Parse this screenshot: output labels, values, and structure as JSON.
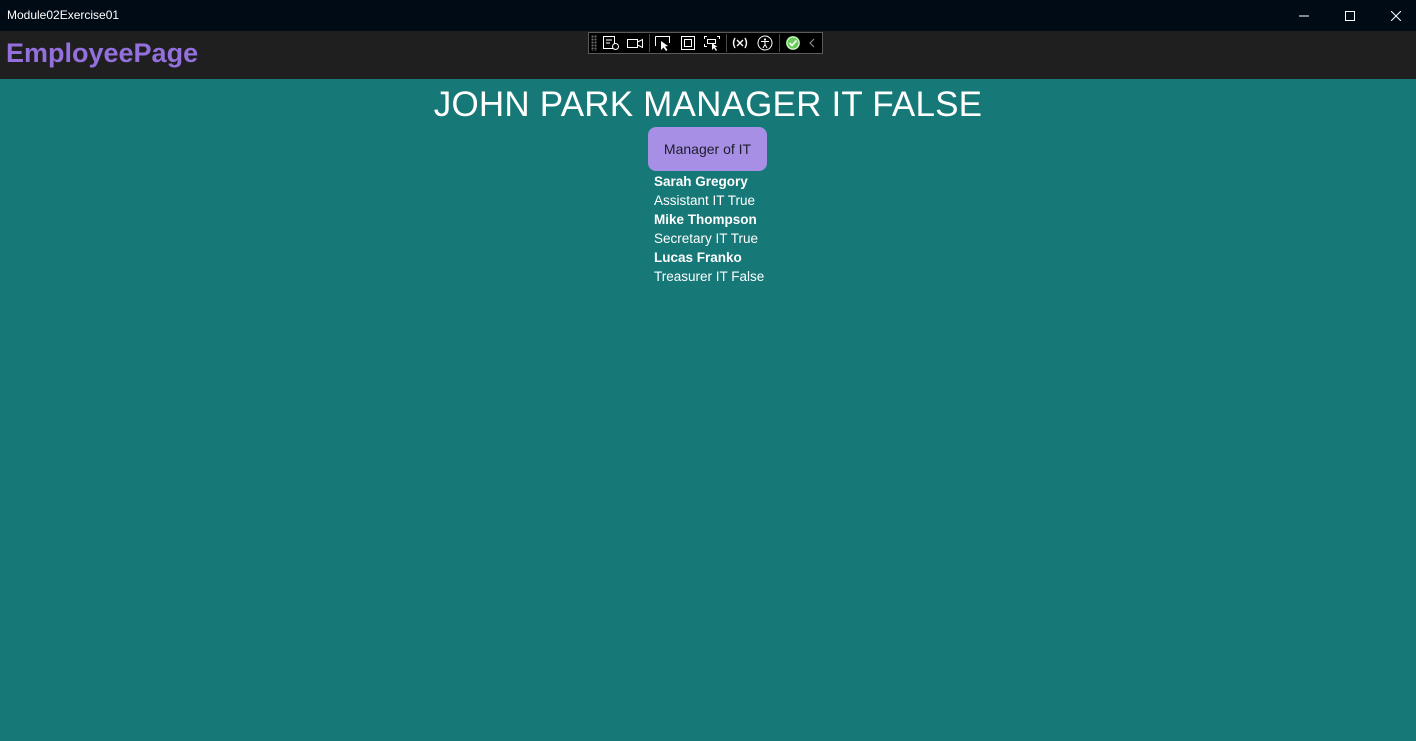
{
  "window": {
    "title": "Module02Exercise01"
  },
  "navbar": {
    "title": "EmployeePage"
  },
  "debug_toolbar": {
    "tools": [
      "live-visual-tree-icon",
      "record-icon",
      "select-element-icon",
      "display-layout-adorners-icon",
      "track-focused-element-icon",
      "binding-failures-icon",
      "accessibility-checker-icon",
      "check-icon",
      "collapse-chevron-icon"
    ]
  },
  "main": {
    "heading": "JOHN PARK MANAGER IT FALSE",
    "role_button": "Manager of IT",
    "employees": [
      {
        "name": "Sarah Gregory",
        "detail": "Assistant IT True"
      },
      {
        "name": "Mike Thompson",
        "detail": "Secretary IT True"
      },
      {
        "name": "Lucas Franko",
        "detail": "Treasurer IT False"
      }
    ]
  },
  "colors": {
    "background": "#177878",
    "titlebar": "#010b16",
    "navbar": "#1f1f1f",
    "nav_title": "#9370db",
    "button": "#a88fe6"
  }
}
